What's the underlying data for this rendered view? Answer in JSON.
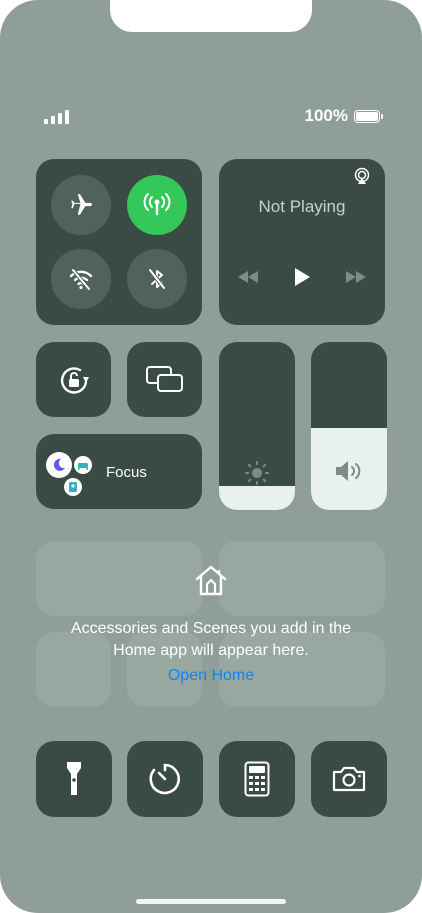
{
  "status_bar": {
    "battery_percent": "100%",
    "signal_bars": 4,
    "battery_level": 1.0
  },
  "connectivity": {
    "airplane_mode": {
      "icon": "airplane-icon",
      "active": false
    },
    "cellular_data": {
      "icon": "antenna-icon",
      "active": true,
      "color": "#34c759"
    },
    "wifi": {
      "icon": "wifi-off-icon",
      "active": false
    },
    "bluetooth": {
      "icon": "bluetooth-off-icon",
      "active": false
    }
  },
  "now_playing": {
    "title": "Not Playing",
    "airplay_icon": "airplay-icon",
    "controls": [
      "rewind-icon",
      "play-icon",
      "fast-forward-icon"
    ]
  },
  "toggles": {
    "orientation_lock": {
      "icon": "rotation-lock-icon"
    },
    "screen_mirroring": {
      "icon": "screen-mirroring-icon"
    }
  },
  "focus": {
    "label": "Focus",
    "icons": [
      "moon-icon",
      "bed-icon",
      "person-badge-icon"
    ]
  },
  "brightness": {
    "icon": "sun-icon",
    "level": 0.14
  },
  "volume": {
    "icon": "speaker-icon",
    "level": 0.49
  },
  "home": {
    "message_line1": "Accessories and Scenes you add in the",
    "message_line2": "Home app will appear here.",
    "open_link": "Open Home",
    "link_color": "#0a84ff"
  },
  "bottom_controls": [
    "flashlight-icon",
    "timer-icon",
    "calculator-icon",
    "camera-icon"
  ]
}
